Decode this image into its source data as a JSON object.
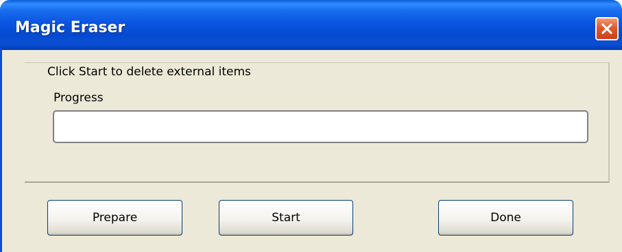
{
  "window": {
    "title": "Magic Eraser"
  },
  "content": {
    "instruction": "Click Start to delete external items",
    "progress_label": "Progress",
    "progress_percent": 0
  },
  "buttons": {
    "prepare": "Prepare",
    "start": "Start",
    "done": "Done"
  },
  "icons": {
    "close": "close-x-icon"
  },
  "colors": {
    "titlebar": "#0a55e0",
    "close_button": "#e2582a",
    "client_background": "#ece9d8",
    "button_border": "#003c74"
  }
}
